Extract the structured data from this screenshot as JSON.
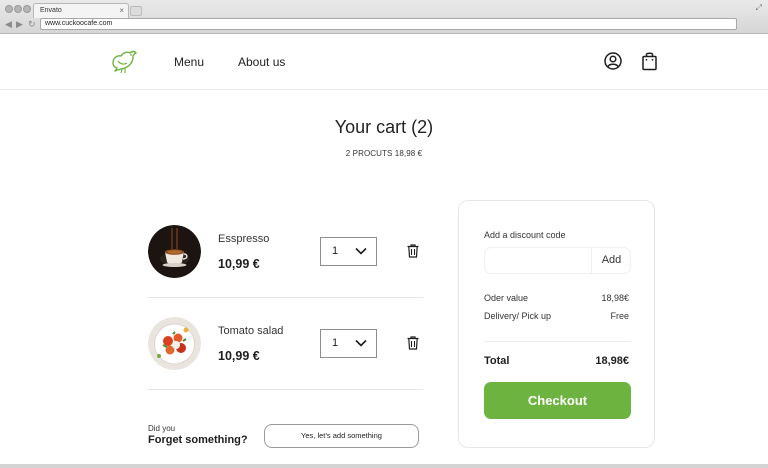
{
  "browser": {
    "tab_title": "Envato",
    "tab_close": "×",
    "url": "www.cuckoocafe.com",
    "back": "◀",
    "forward": "▶",
    "reload": "↻",
    "resize": "⤢"
  },
  "header": {
    "nav": [
      {
        "label": "Menu"
      },
      {
        "label": "About us"
      }
    ],
    "icons": [
      "user-icon",
      "shopping-bag-icon"
    ],
    "logo_icon": "bird-logo-icon"
  },
  "cart": {
    "title": "Your cart (2)",
    "summary": "2 PROCUTS 18,98 €",
    "items": [
      {
        "name": "Esspresso",
        "price": "10,99 €",
        "qty": "1"
      },
      {
        "name": "Tomato salad",
        "price": "10,99 €",
        "qty": "1"
      }
    ]
  },
  "upsell": {
    "did_you": "Did you",
    "forget": "Forget something?",
    "button": "Yes, let’s add something"
  },
  "summary_panel": {
    "discount_label": "Add a discount code",
    "discount_placeholder": "",
    "discount_add": "Add",
    "rows": [
      {
        "label": "Oder value",
        "value": "18,98€"
      },
      {
        "label": "Delivery/ Pick up",
        "value": "Free"
      }
    ],
    "total_label": "Total",
    "total_value": "18,98€",
    "checkout": "Checkout"
  },
  "colors": {
    "accent": "#6db33f"
  }
}
